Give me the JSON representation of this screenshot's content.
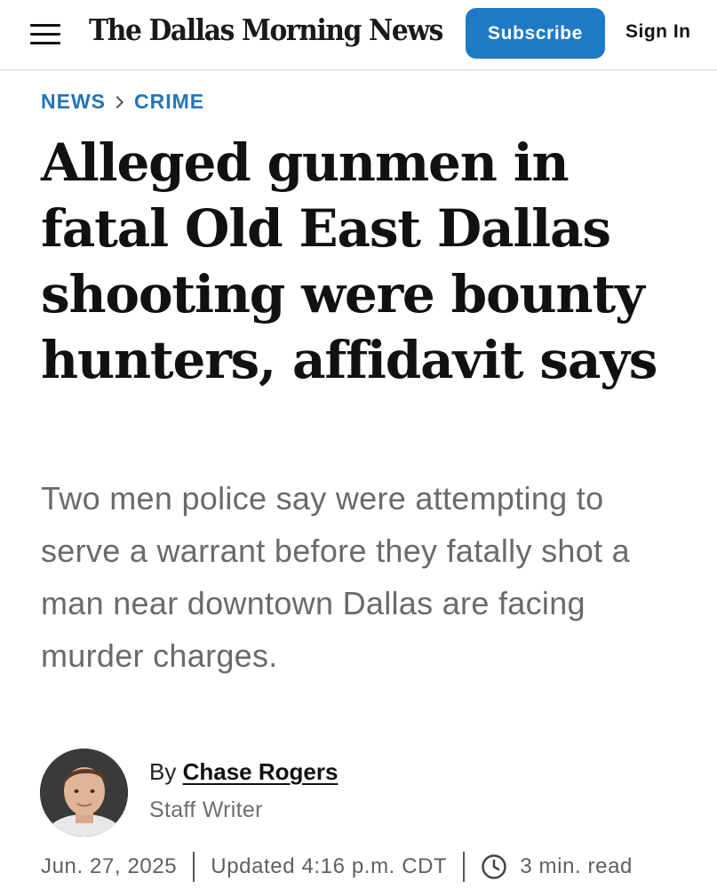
{
  "header": {
    "masthead": "The Dallas Morning News",
    "subscribe_label": "Subscribe",
    "signin_label": "Sign In"
  },
  "breadcrumb": {
    "section": "NEWS",
    "subsection": "CRIME"
  },
  "article": {
    "headline": "Alleged gunmen in fatal Old East Dallas shooting were bounty hunters, affidavit says",
    "dek": "Two men police say were attempting to serve a warrant before they fatally shot a man near downtown Dallas are facing murder charges."
  },
  "byline": {
    "prefix": "By",
    "author": "Chase Rogers",
    "role": "Staff Writer"
  },
  "meta": {
    "date": "Jun. 27, 2025",
    "updated": "Updated 4:16 p.m. CDT",
    "read_time": "3 min. read"
  },
  "colors": {
    "accent": "#1f7ac6",
    "breadcrumb": "#2374b8",
    "dek_text": "#6a6a6a"
  },
  "icons": [
    "hamburger-menu-icon",
    "chevron-right-icon",
    "clock-icon"
  ]
}
